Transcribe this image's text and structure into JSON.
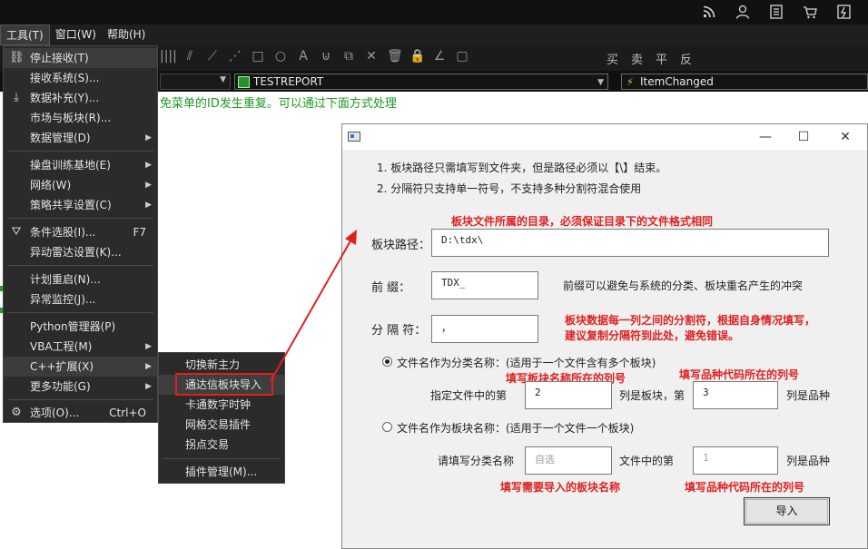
{
  "topbar": {
    "icons": [
      "rss-icon",
      "user-icon",
      "document-icon",
      "cart-icon",
      "app-icon"
    ]
  },
  "menubar": {
    "items": [
      "工具(T)",
      "窗口(W)",
      "帮助(H)"
    ]
  },
  "toolbar": {
    "tool_icons": [
      "||||",
      "⫽",
      "⟋",
      "⋰",
      "□",
      "○",
      "A",
      "⊍",
      "⧉",
      "✕",
      "🗑",
      "🔒",
      "∠",
      "▢"
    ],
    "trade": [
      "买",
      "卖",
      "平",
      "反"
    ]
  },
  "combobar": {
    "stock": "TESTREPORT",
    "event": "ItemChanged"
  },
  "background_text": "免菜单的ID发生重复。可以通过下面方式处理",
  "menu": {
    "items": [
      {
        "label": "停止接收(T)",
        "icon": "link-icon"
      },
      {
        "label": "接收系统(S)..."
      },
      {
        "label": "数据补充(Y)...",
        "icon": "download-icon"
      },
      {
        "label": "市场与板块(R)..."
      },
      {
        "label": "数据管理(D)",
        "submenu": true
      },
      {
        "label": "操盘训练基地(E)",
        "submenu": true
      },
      {
        "label": "网络(W)",
        "submenu": true
      },
      {
        "label": "策略共享设置(C)",
        "submenu": true
      },
      {
        "label": "条件选股(I)...",
        "icon": "filter-icon",
        "shortcut": "F7"
      },
      {
        "label": "异动雷达设置(K)..."
      },
      {
        "label": "计划重启(N)..."
      },
      {
        "label": "异常监控(J)..."
      },
      {
        "label": "Python管理器(P)"
      },
      {
        "label": "VBA工程(M)",
        "submenu": true
      },
      {
        "label": "C++扩展(X)",
        "submenu": true
      },
      {
        "label": "更多功能(G)",
        "submenu": true
      },
      {
        "label": "选项(O)...",
        "icon": "gear-icon",
        "shortcut": "Ctrl+O"
      }
    ]
  },
  "submenu": {
    "items": [
      "切换新主力",
      "通达信板块导入",
      "卡通数字时钟",
      "网格交易插件",
      "拐点交易",
      "插件管理(M)..."
    ]
  },
  "dialog": {
    "note1": "1. 板块路径只需填写到文件夹，但是路径必须以【\\】结束。",
    "note2": "2. 分隔符只支持单一符号，不支持多种分割符混合使用",
    "red_path": "板块文件所属的目录，必须保证目录下的文件格式相同",
    "path_label": "板块路径：",
    "path_value": "D:\\tdx\\",
    "prefix_label": "前    缀：",
    "prefix_value": "TDX_",
    "prefix_note": "前缀可以避免与系统的分类、板块重名产生的冲突",
    "sep_label": "分 隔 符：",
    "sep_value": "，",
    "red_sep1": "板块数据每一列之间的分割符，根据自身情况填写，",
    "red_sep2": "建议复制分隔符到此处，避免错误。",
    "radio1": "文件名作为分类名称：(适用于一个文件含有多个板块)",
    "red_col1": "填写板块名称所在的列号",
    "red_col2": "填写品种代码所在的列号",
    "r1_label1": "指定文件中的第",
    "r1_value1": "2",
    "r1_label2": "列是板块，第",
    "r1_value2": "3",
    "r1_label3": "列是品种",
    "radio2": "文件名作为板块名称：(适用于一个文件一个板块)",
    "r2_label1": "请填写分类名称",
    "r2_placeholder": "自选",
    "r2_label2": "文件中的第",
    "r2_value": "1",
    "r2_label3": "列是品种",
    "red_name": "填写需要导入的板块名称",
    "red_col3": "填写品种代码所在的列号",
    "import_button": "导入",
    "window_buttons": [
      "—",
      "☐",
      "✕"
    ]
  },
  "colors": {
    "annotation_red": "#e02020",
    "menu_bg": "#2b2b2b",
    "bg_green_text": "#1a9a1a"
  }
}
